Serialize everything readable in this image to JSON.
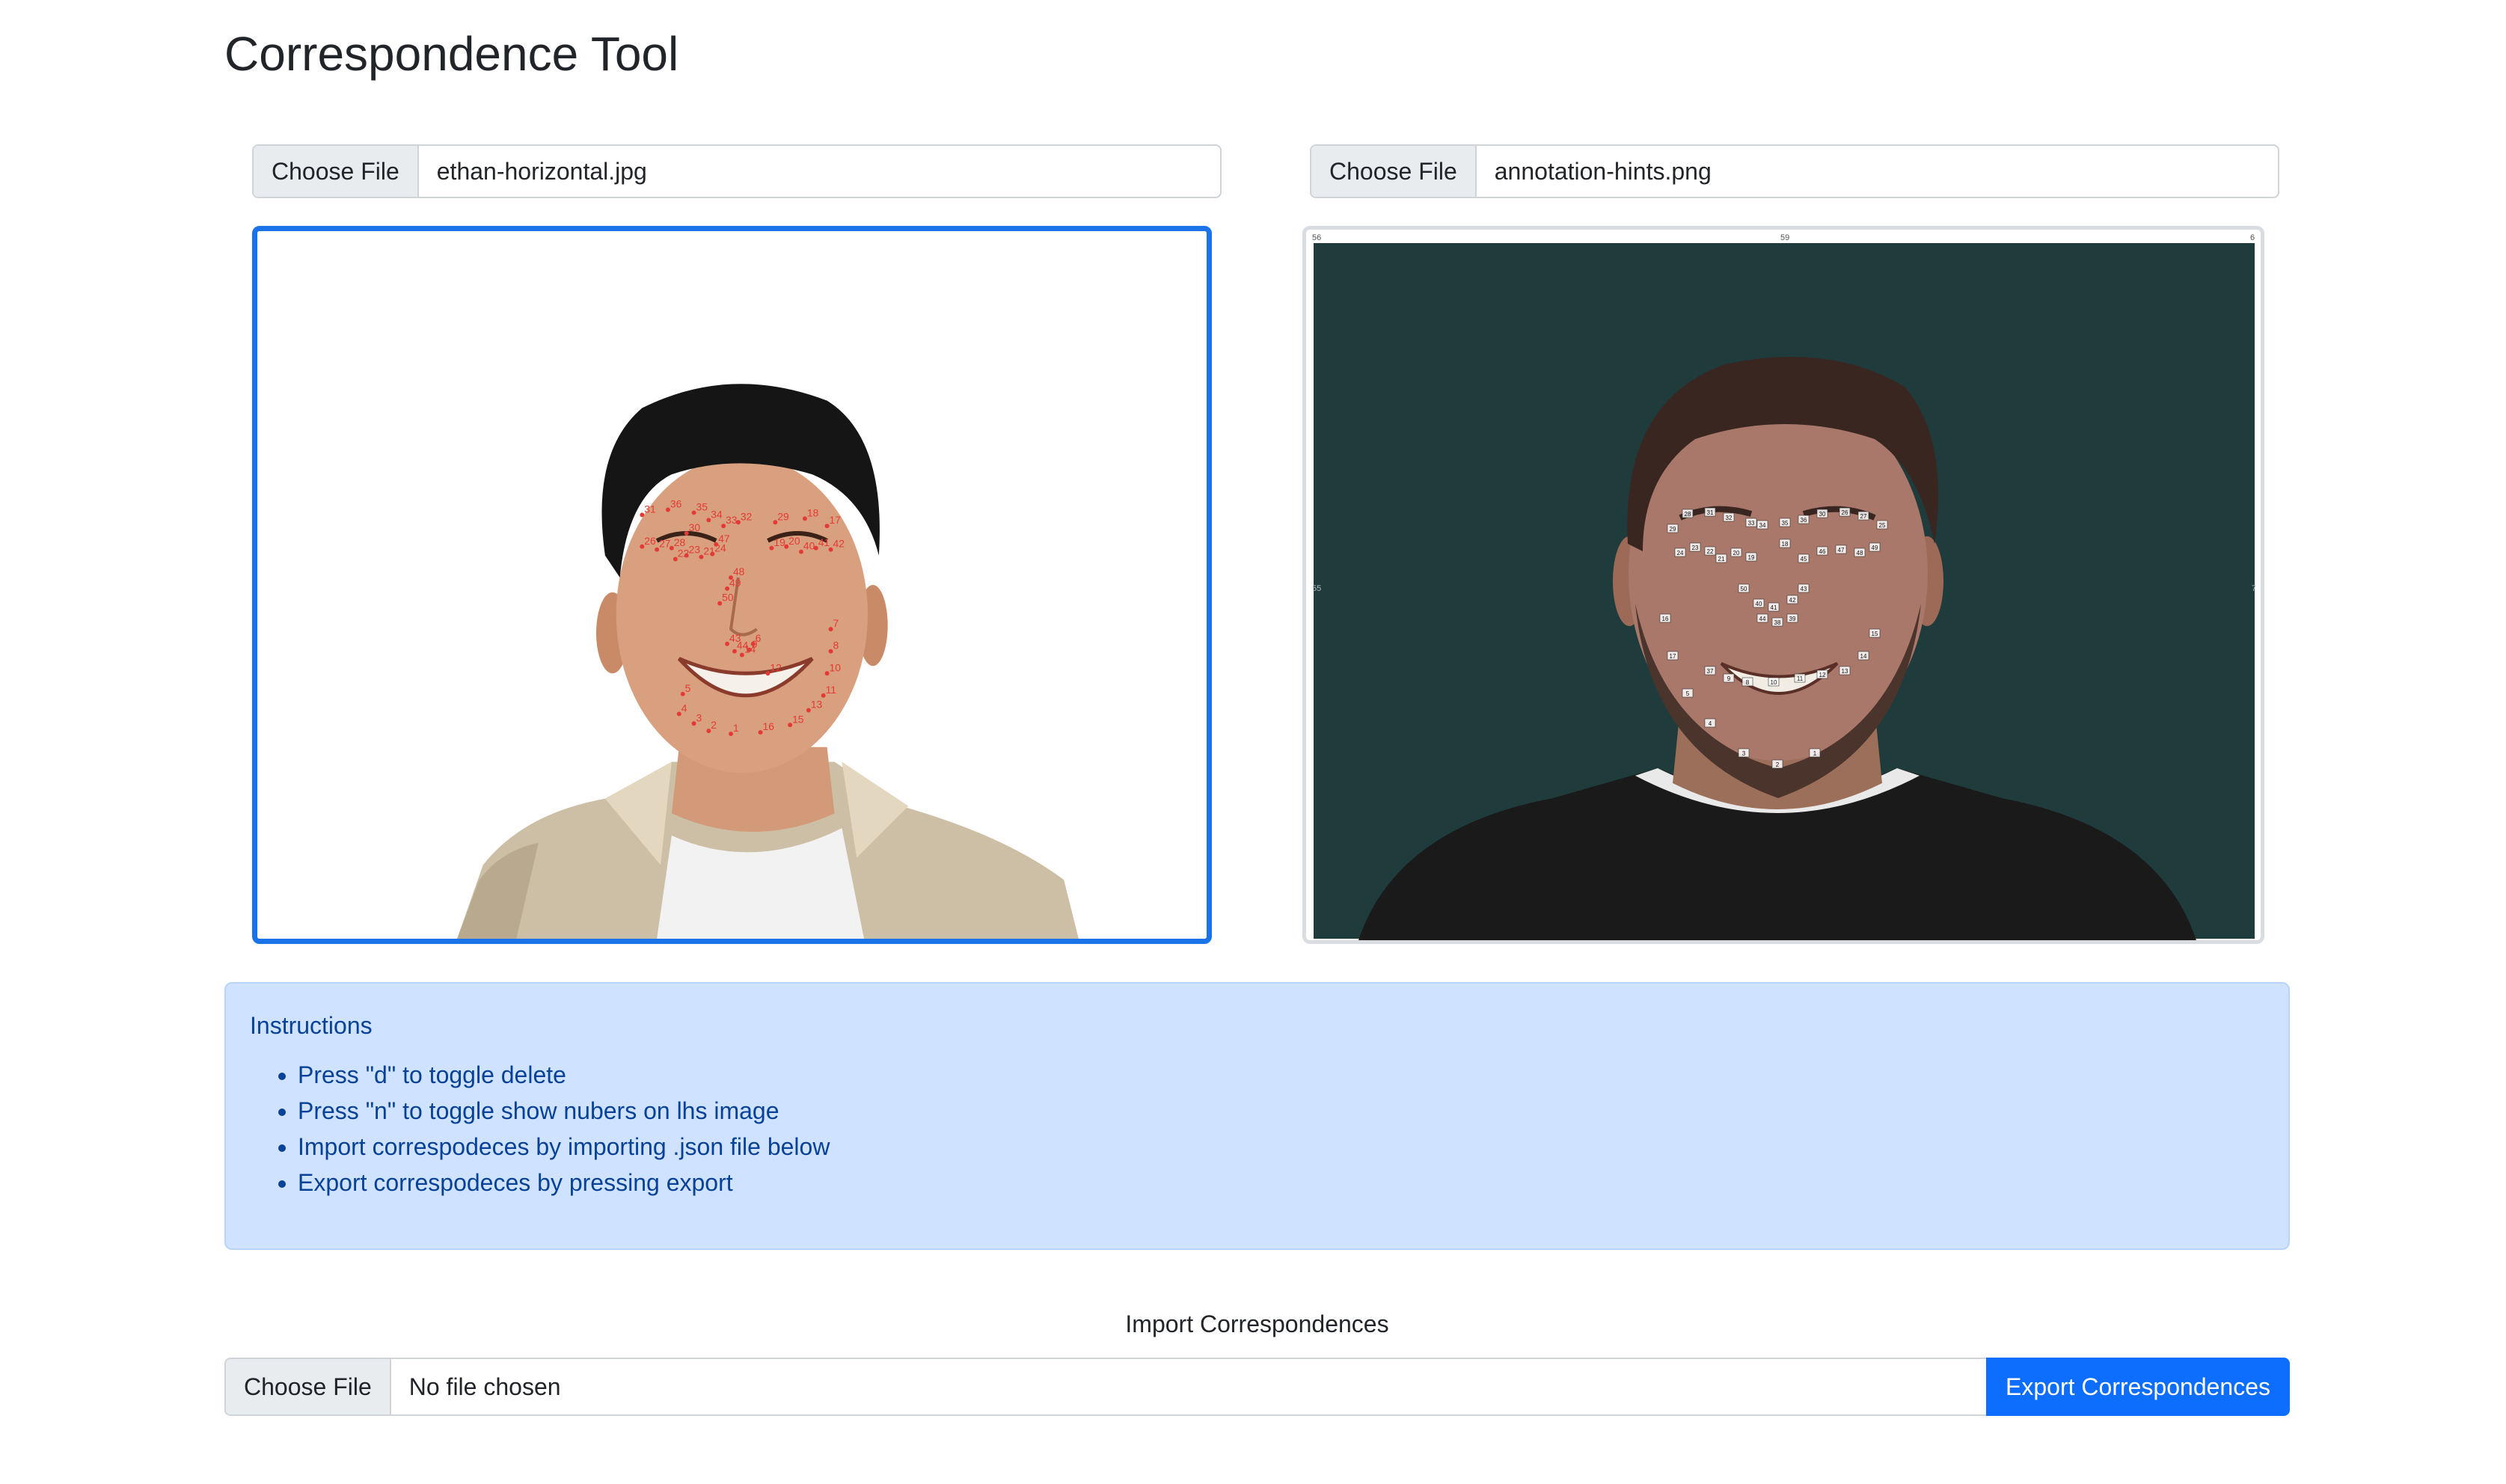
{
  "page": {
    "title": "Correspondence Tool"
  },
  "left": {
    "button_label": "Choose File",
    "file_name": "ethan-horizontal.jpg"
  },
  "right": {
    "button_label": "Choose File",
    "file_name": "annotation-hints.png",
    "corner_labels": {
      "top_left": "56",
      "top_center": "59",
      "top_right": "6",
      "mid_left": "55",
      "mid_right": "7"
    }
  },
  "instructions": {
    "heading": "Instructions",
    "items": [
      "Press \"d\" to toggle delete",
      "Press \"n\" to toggle show nubers on lhs image",
      "Import correspodeces by importing .json file below",
      "Export correspodeces by pressing export"
    ]
  },
  "import": {
    "label": "Import Correspondences",
    "button_label": "Choose File",
    "file_name": "No file chosen",
    "export_label": "Export Correspondences"
  },
  "colors": {
    "accent": "#1a73e8",
    "export_button": "#0d6efd",
    "alert_bg": "#cfe2ff",
    "alert_text": "#084298",
    "point_marker": "#e53935",
    "backdrop": "#1f3b3c"
  },
  "left_points": [
    "31",
    "36",
    "35",
    "34",
    "33",
    "32",
    "30",
    "47",
    "28",
    "27",
    "26",
    "22",
    "23",
    "21",
    "24",
    "29",
    "18",
    "17",
    "48",
    "49",
    "50",
    "19",
    "20",
    "40",
    "41",
    "42",
    "43",
    "44",
    "14",
    "9",
    "6",
    "5",
    "4",
    "3",
    "2",
    "1",
    "16",
    "15",
    "13",
    "11",
    "10",
    "8",
    "7",
    "12"
  ],
  "right_points": [
    "29",
    "28",
    "31",
    "32",
    "33",
    "34",
    "35",
    "36",
    "30",
    "26",
    "27",
    "25",
    "24",
    "23",
    "22",
    "21",
    "20",
    "19",
    "18",
    "45",
    "46",
    "47",
    "48",
    "49",
    "50",
    "40",
    "41",
    "42",
    "43",
    "44",
    "38",
    "39",
    "37",
    "9",
    "8",
    "10",
    "11",
    "12",
    "13",
    "14",
    "15",
    "16",
    "17",
    "5",
    "4",
    "3",
    "2",
    "1"
  ]
}
